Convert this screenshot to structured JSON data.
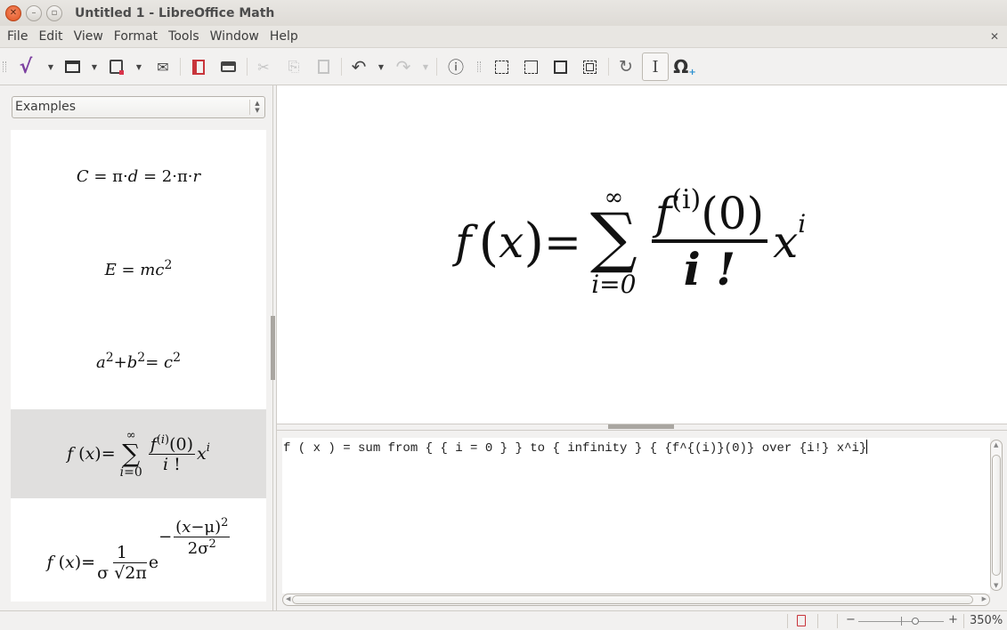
{
  "window": {
    "title": "Untitled 1 - LibreOffice Math",
    "close_glyph": "✕",
    "min_glyph": "–",
    "max_glyph": "▫"
  },
  "menubar": {
    "items": [
      {
        "label": "File"
      },
      {
        "label": "Edit"
      },
      {
        "label": "View"
      },
      {
        "label": "Format"
      },
      {
        "label": "Tools"
      },
      {
        "label": "Window"
      },
      {
        "label": "Help"
      }
    ],
    "close_document_glyph": "✕"
  },
  "toolbar": {
    "buttons": [
      {
        "name": "new-formula",
        "glyph": "√",
        "color": "#7b3fa0"
      },
      {
        "name": "open",
        "glyph": "🗀"
      },
      {
        "name": "save",
        "glyph": "💾"
      },
      {
        "name": "email",
        "glyph": "✉"
      },
      {
        "name": "export-pdf",
        "glyph": "⎙",
        "color": "#c8353b"
      },
      {
        "name": "print",
        "glyph": "🖶"
      },
      {
        "name": "cut",
        "glyph": "✂"
      },
      {
        "name": "copy",
        "glyph": "⎘"
      },
      {
        "name": "paste",
        "glyph": "📋"
      },
      {
        "name": "undo",
        "glyph": "↶"
      },
      {
        "name": "redo",
        "glyph": "↷"
      },
      {
        "name": "formula-cursor-info",
        "glyph": "ⓘ"
      },
      {
        "name": "zoom-in",
        "glyph": "⤢"
      },
      {
        "name": "zoom-out",
        "glyph": "⤡"
      },
      {
        "name": "show-all",
        "glyph": "▢"
      },
      {
        "name": "zoom-optimal",
        "glyph": "⊡"
      },
      {
        "name": "update",
        "glyph": "↻"
      },
      {
        "name": "formula-cursor",
        "glyph": "I"
      },
      {
        "name": "symbols",
        "glyph": "Ω"
      }
    ]
  },
  "sidebar": {
    "category_select": {
      "value": "Examples"
    },
    "examples": [
      {
        "name": "circle-circumference",
        "text": "C = π·d = 2·π·r"
      },
      {
        "name": "mass-energy",
        "text": "E = mc²"
      },
      {
        "name": "pythagoras",
        "text": "a² + b² = c²"
      },
      {
        "name": "taylor-series",
        "text": "f(x) = Σ f⁽ⁱ⁾(0)/i! xⁱ",
        "selected": true
      },
      {
        "name": "normal-distribution",
        "text": "f(x) = 1/(σ√2π) e^-(x-μ)²/2σ²"
      }
    ]
  },
  "formula": {
    "f": "f",
    "x": "x",
    "sum_from": "i=0",
    "sum_to": "∞",
    "numerator_f": "f",
    "numerator_sup": "(i)",
    "numerator_arg": "(0)",
    "denominator": "i !",
    "term_x": "x",
    "term_sup": "i"
  },
  "editor": {
    "text": "f ( x ) = sum from { { i = 0 } } to { infinity } { {f^{(i)}(0)} over {i!} x^i}"
  },
  "statusbar": {
    "zoom_minus": "−",
    "zoom_plus": "+",
    "zoom_level": "350%",
    "zoom_slider_value": 350
  },
  "colors": {
    "accent_math": "#7b3fa0",
    "pdf_red": "#c8353b",
    "close_orange": "#e0521f"
  }
}
